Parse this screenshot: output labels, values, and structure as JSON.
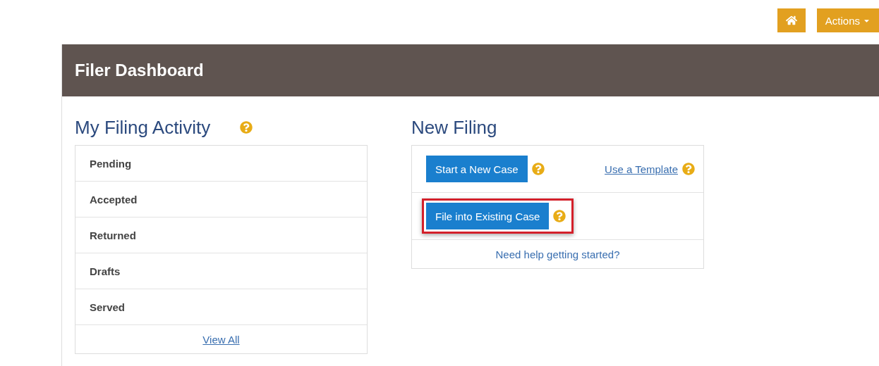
{
  "top_bar": {
    "actions_label": "Actions"
  },
  "dashboard": {
    "title": "Filer Dashboard"
  },
  "filing_activity": {
    "heading": "My Filing Activity",
    "items": [
      "Pending",
      "Accepted",
      "Returned",
      "Drafts",
      "Served"
    ],
    "view_all": "View All"
  },
  "new_filing": {
    "heading": "New Filing",
    "actions": [
      {
        "kind": "button",
        "label": "Start a New Case",
        "highlighted": false,
        "link": "Use a Template"
      },
      {
        "kind": "button",
        "label": "File into Existing Case",
        "highlighted": true
      }
    ],
    "help_link": "Need help getting started?"
  }
}
